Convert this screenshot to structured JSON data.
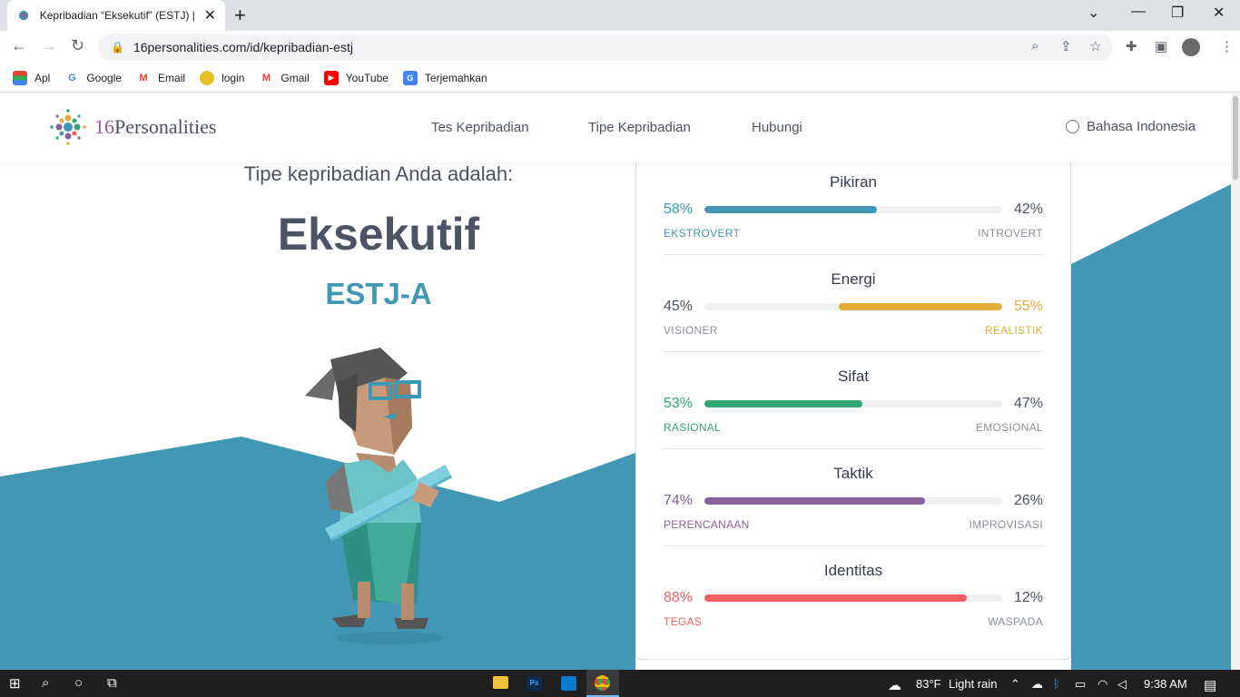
{
  "browser": {
    "tab_title": "Kepribadian “Eksekutif” (ESTJ) | 16",
    "url": "16personalities.com/id/kepribadian-estj",
    "bookmarks": [
      {
        "label": "Apl",
        "icon": "apps-grid-icon"
      },
      {
        "label": "Google",
        "icon": "google-icon"
      },
      {
        "label": "Email",
        "icon": "gmail-icon"
      },
      {
        "label": "login",
        "icon": "university-logo-icon"
      },
      {
        "label": "Gmail",
        "icon": "gmail-icon"
      },
      {
        "label": "YouTube",
        "icon": "youtube-icon"
      },
      {
        "label": "Terjemahkan",
        "icon": "translate-icon"
      }
    ]
  },
  "site": {
    "brand_number": "16",
    "brand_word": "Personalities",
    "nav": [
      "Tes Kepribadian",
      "Tipe Kepribadian",
      "Hubungi"
    ],
    "language": "Bahasa Indonesia"
  },
  "result": {
    "intro": "Tipe kepribadian Anda adalah:",
    "type_name": "Eksekutif",
    "type_code": "ESTJ-A"
  },
  "traits": [
    {
      "title": "Pikiran",
      "left_pct": "58%",
      "right_pct": "42%",
      "left_label": "EKSTROVERT",
      "right_label": "INTROVERT",
      "fill_fraction": 0.58,
      "fill_side": "left",
      "color": "#4298b4"
    },
    {
      "title": "Energi",
      "left_pct": "45%",
      "right_pct": "55%",
      "left_label": "VISIONER",
      "right_label": "REALISTIK",
      "fill_fraction": 0.55,
      "fill_side": "right",
      "color": "#e4ae3a"
    },
    {
      "title": "Sifat",
      "left_pct": "53%",
      "right_pct": "47%",
      "left_label": "RASIONAL",
      "right_label": "EMOSIONAL",
      "fill_fraction": 0.53,
      "fill_side": "left",
      "color": "#33a474"
    },
    {
      "title": "Taktik",
      "left_pct": "74%",
      "right_pct": "26%",
      "left_label": "PERENCANAAN",
      "right_label": "IMPROVISASI",
      "fill_fraction": 0.74,
      "fill_side": "left",
      "color": "#88619a"
    },
    {
      "title": "Identitas",
      "left_pct": "88%",
      "right_pct": "12%",
      "left_label": "TEGAS",
      "right_label": "WASPADA",
      "fill_fraction": 0.88,
      "fill_side": "left",
      "color": "#f25e62"
    }
  ],
  "taskbar": {
    "weather_temp": "83°F",
    "weather_text": "Light rain",
    "time": "9:38 AM"
  },
  "colors": {
    "accent_blue": "#4298b4",
    "text_dark": "#4c5362",
    "neutral_gray": "#8a8f98"
  }
}
